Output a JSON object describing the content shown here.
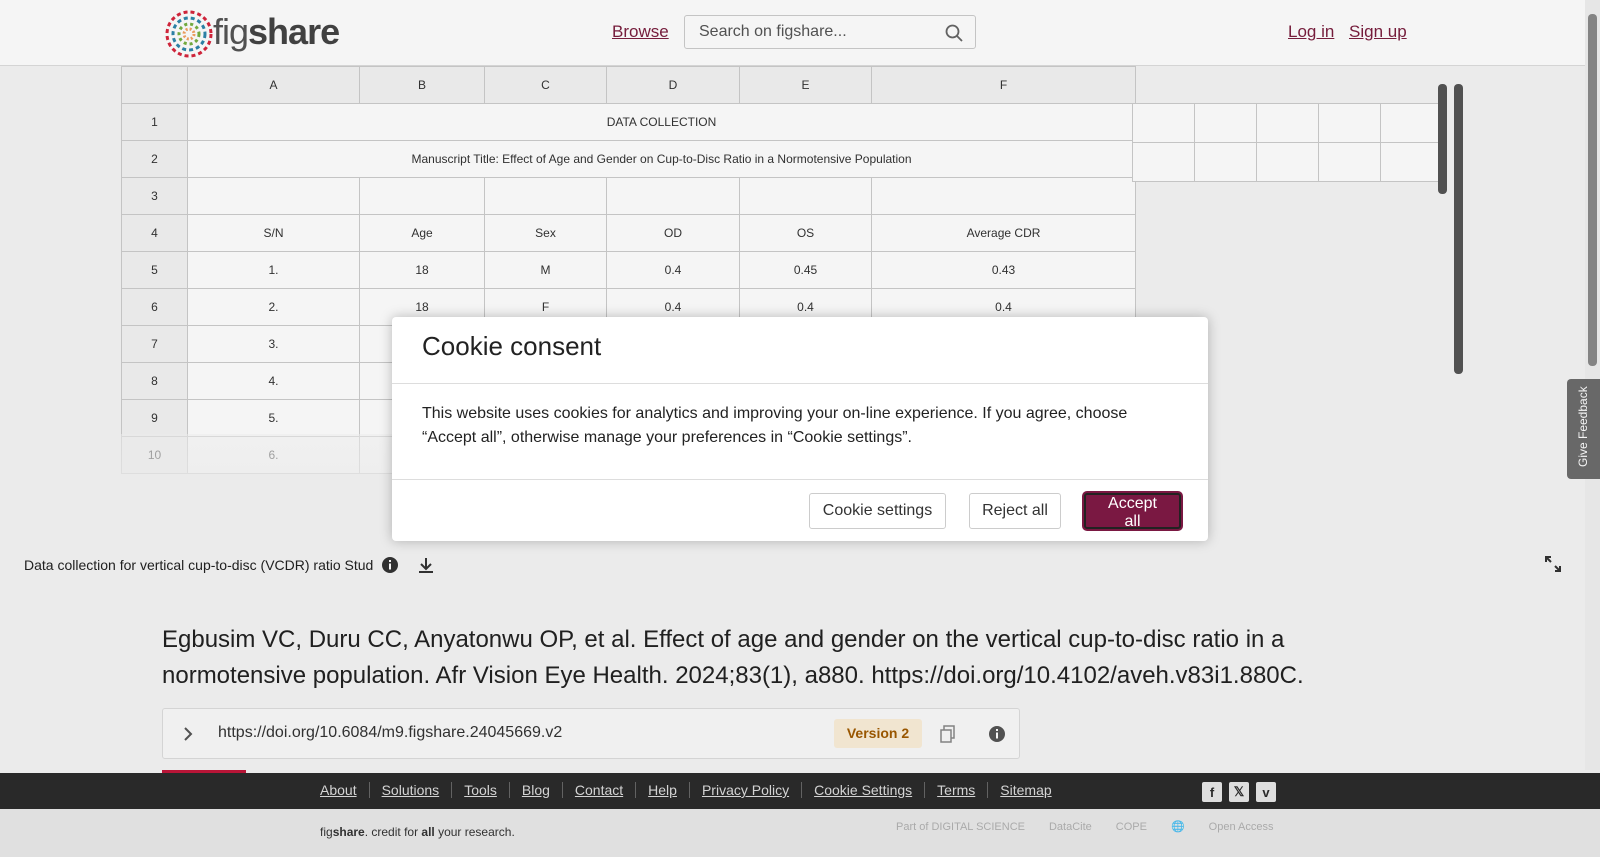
{
  "header": {
    "logo_text_fig": "fig",
    "logo_text_share": "share",
    "browse": "Browse",
    "search_placeholder": "Search on figshare...",
    "login": "Log in",
    "signup": "Sign up"
  },
  "sheet": {
    "columns": [
      "A",
      "B",
      "C",
      "D",
      "E",
      "F"
    ],
    "row_numbers": [
      "1",
      "2",
      "3",
      "4",
      "5",
      "6",
      "7",
      "8",
      "9",
      "10"
    ],
    "title_row": "DATA COLLECTION",
    "manuscript_row": "Manuscript Title: Effect of Age and Gender on Cup-to-Disc Ratio in a Normotensive Population",
    "headers": [
      "S/N",
      "Age",
      "Sex",
      "OD",
      "OS",
      "Average CDR"
    ],
    "rows": [
      [
        "1.",
        "18",
        "M",
        "0.4",
        "0.45",
        "0.43"
      ],
      [
        "2.",
        "18",
        "F",
        "0.4",
        "0.4",
        "0.4"
      ],
      [
        "3.",
        "",
        "",
        "",
        "",
        ""
      ],
      [
        "4.",
        "",
        "",
        "",
        "",
        ""
      ],
      [
        "5.",
        "",
        "",
        "",
        "",
        ""
      ],
      [
        "6.",
        "",
        "",
        "",
        "",
        ""
      ]
    ]
  },
  "filebar": {
    "filename": "Data collection for vertical cup-to-disc (VCDR) ratio Stud"
  },
  "citation": "Egbusim VC, Duru CC, Anyatonwu OP, et al. Effect of age and gender on the vertical cup-to-disc ratio in a normotensive population. Afr Vision Eye Health. 2024;83(1), a880. https://doi.org/10.4102/aveh.v83i1.880C.",
  "doi": {
    "url": "https://doi.org/10.6084/m9.figshare.24045669.v2",
    "version": "Version 2"
  },
  "footer": {
    "links": [
      "About",
      "Solutions",
      "Tools",
      "Blog",
      "Contact",
      "Help",
      "Privacy Policy",
      "Cookie Settings",
      "Terms",
      "Sitemap"
    ],
    "tagline_fig": "fig",
    "tagline_share": "share",
    "tagline_rest1": ". credit for ",
    "tagline_all": "all",
    "tagline_rest2": " your research.",
    "partners": [
      "Part of DIGITAL SCIENCE",
      "DataCite",
      "COPE",
      "",
      "Open Access"
    ]
  },
  "cookie": {
    "title": "Cookie consent",
    "body": "This website uses cookies for analytics and improving your on-line experience. If you agree, choose “Accept all”, otherwise manage your preferences in “Cookie settings”.",
    "settings": "Cookie settings",
    "reject": "Reject all",
    "accept": "Accept all"
  },
  "feedback": "Give Feedback",
  "colors": {
    "brand": "#7a1842",
    "link": "#7a1e3e",
    "version_badge": "#fbefd9"
  }
}
